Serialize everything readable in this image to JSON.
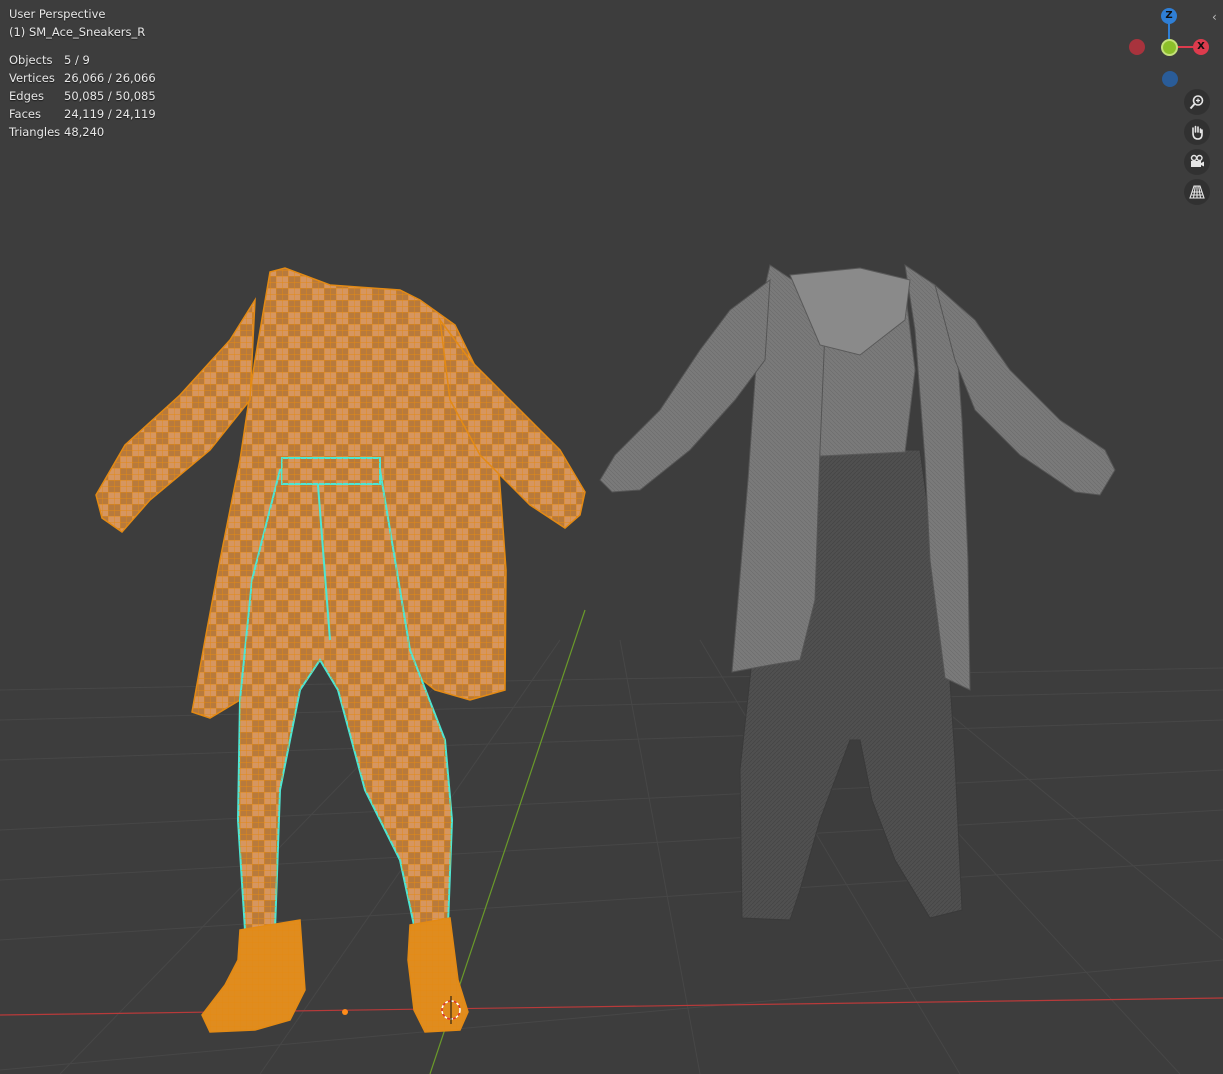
{
  "viewport": {
    "view_name": "User Perspective",
    "active_object": "(1) SM_Ace_Sneakers_R",
    "stats": [
      {
        "label": "Objects",
        "value": "5 / 9"
      },
      {
        "label": "Vertices",
        "value": "26,066 / 26,066"
      },
      {
        "label": "Edges",
        "value": "50,085 / 50,085"
      },
      {
        "label": "Faces",
        "value": "24,119 / 24,119"
      },
      {
        "label": "Triangles",
        "value": "48,240"
      }
    ]
  },
  "gizmo": {
    "axes": [
      {
        "name": "z",
        "label": "Z",
        "color": "#2f7fd6"
      },
      {
        "name": "x",
        "label": "X",
        "color": "#dd3b4d"
      },
      {
        "name": "neg-x",
        "label": "",
        "color": "#a8333d"
      },
      {
        "name": "y",
        "label": "",
        "color": "#8cbf2a"
      },
      {
        "name": "neg-z",
        "label": "",
        "color": "#2a5c98"
      }
    ]
  },
  "navigation": [
    {
      "icon": "zoom-icon"
    },
    {
      "icon": "pan-hand-icon"
    },
    {
      "icon": "camera-icon"
    },
    {
      "icon": "grid-perspective-icon"
    }
  ],
  "colors": {
    "background": "#3d3d3d",
    "selected_wire": "#e38a14",
    "active_outline": "#4de6d3",
    "unselected_mesh": "#7b7b7b",
    "x_axis_line": "#b83a3a",
    "y_axis_line": "#6a9a2a"
  }
}
